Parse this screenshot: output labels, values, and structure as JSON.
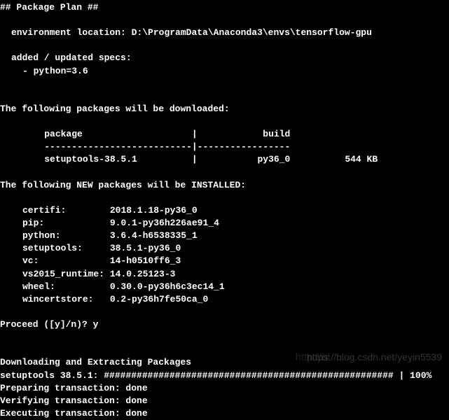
{
  "header": "## Package Plan ##",
  "env_label": "environment location: ",
  "env_path": "D:\\ProgramData\\Anaconda3\\envs\\tensorflow-gpu",
  "specs_label": "added / updated specs:",
  "specs_item": "- python=3.6",
  "download_header": "The following packages will be downloaded:",
  "table": {
    "col1": "package",
    "col2": "build",
    "sep": "---------------------------|-----------------",
    "row_name": "setuptools-38.5.1",
    "row_build": "py36_0",
    "row_size": "544 KB"
  },
  "install_header": "The following NEW packages will be INSTALLED:",
  "packages": [
    {
      "name": "certifi:",
      "ver": "2018.1.18-py36_0"
    },
    {
      "name": "pip:",
      "ver": "9.0.1-py36h226ae91_4"
    },
    {
      "name": "python:",
      "ver": "3.6.4-h6538335_1"
    },
    {
      "name": "setuptools:",
      "ver": "38.5.1-py36_0"
    },
    {
      "name": "vc:",
      "ver": "14-h0510ff6_3"
    },
    {
      "name": "vs2015_runtime:",
      "ver": "14.0.25123-3"
    },
    {
      "name": "wheel:",
      "ver": "0.30.0-py36h6c3ec14_1"
    },
    {
      "name": "wincertstore:",
      "ver": "0.2-py36h7fe50ca_0"
    }
  ],
  "proceed_prompt": "Proceed ([y]/n)? ",
  "proceed_answer": "y",
  "download_section": "Downloading and Extracting Packages",
  "progress_label": "setuptools 38.5.1: ",
  "progress_bar": "##################################################### | 100%",
  "prepare": "Preparing transaction: done",
  "verify": "Verifying transaction: done",
  "execute": "Executing transaction: done",
  "watermark": "https://blog.csdn.net/yeyin5539",
  "watermark2": "http://bl"
}
